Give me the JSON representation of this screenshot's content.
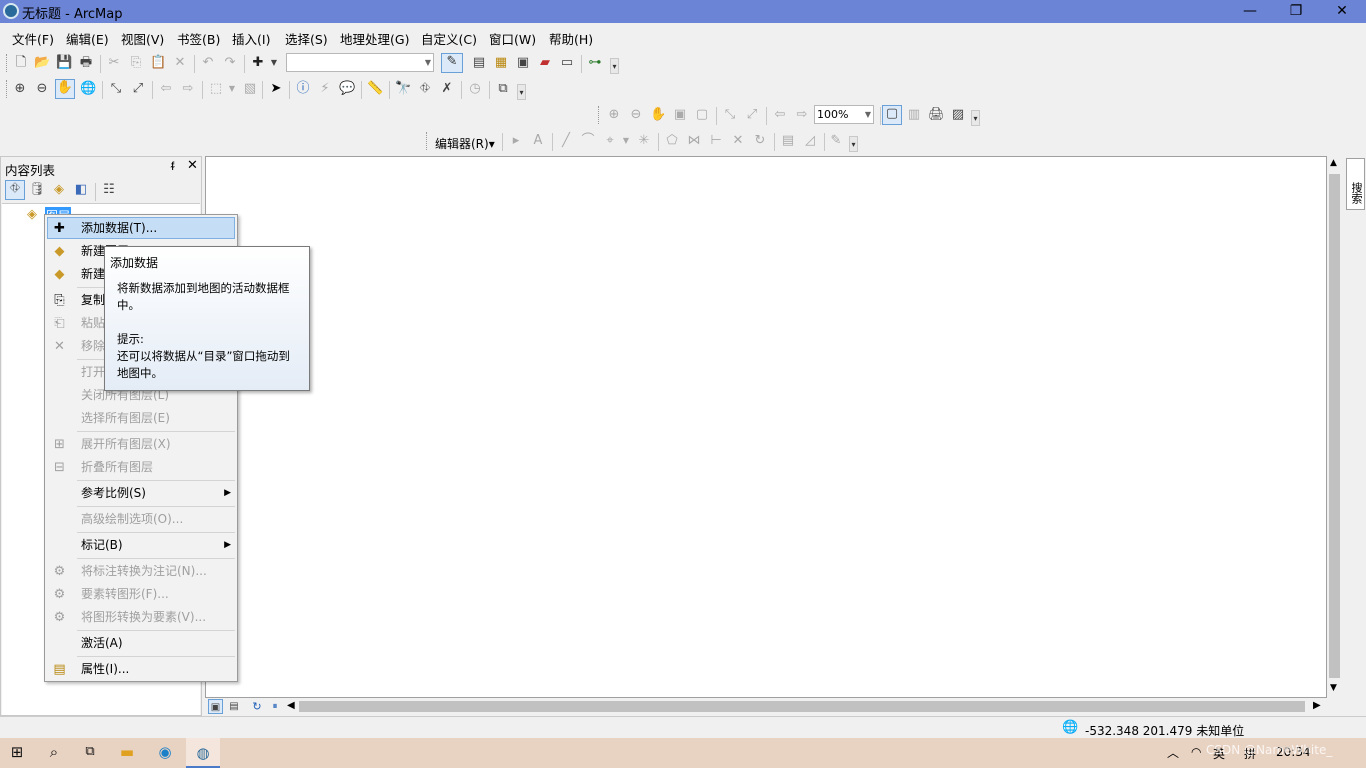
{
  "window": {
    "title": "无标题 - ArcMap",
    "minimize": "—",
    "restore": "❐",
    "close": "✕"
  },
  "menu": [
    "文件(F)",
    "编辑(E)",
    "视图(V)",
    "书签(B)",
    "插入(I)",
    "选择(S)",
    "地理处理(G)",
    "自定义(C)",
    "窗口(W)",
    "帮助(H)"
  ],
  "toolbar": {
    "scale_value": "",
    "zoom_value": "100%",
    "editor_label": "编辑器(R)▾"
  },
  "toc": {
    "title": "内容列表",
    "layer_name": "图层",
    "pin": "ᵮ",
    "close": "✕"
  },
  "context_menu": {
    "items": [
      {
        "label": "添加数据(T)...",
        "icon": "add-data-icon",
        "glyph": "✚",
        "enabled": true
      },
      {
        "label": "新建图层...",
        "icon": "new-layer-icon",
        "glyph": "◆",
        "enabled": true
      },
      {
        "label": "新建图层组",
        "icon": "new-group-icon",
        "glyph": "◆",
        "enabled": true
      },
      {
        "label": "复制",
        "icon": "copy-icon",
        "glyph": "⎘",
        "enabled": true
      },
      {
        "label": "粘贴图层",
        "icon": "paste-icon",
        "glyph": "⎗",
        "enabled": false
      },
      {
        "label": "移除",
        "icon": "remove-icon",
        "glyph": "✕",
        "enabled": false
      },
      {
        "label": "打开所有图层",
        "icon": "",
        "glyph": "",
        "enabled": false
      },
      {
        "label": "关闭所有图层(L)",
        "icon": "",
        "glyph": "",
        "enabled": false
      },
      {
        "label": "选择所有图层(E)",
        "icon": "",
        "glyph": "",
        "enabled": false
      },
      {
        "label": "展开所有图层(X)",
        "icon": "expand-icon",
        "glyph": "⊞",
        "enabled": false
      },
      {
        "label": "折叠所有图层",
        "icon": "collapse-icon",
        "glyph": "⊟",
        "enabled": false
      },
      {
        "label": "参考比例(S)",
        "icon": "",
        "glyph": "",
        "enabled": true,
        "submenu": "▶"
      },
      {
        "label": "高级绘制选项(O)...",
        "icon": "",
        "glyph": "",
        "enabled": false
      },
      {
        "label": "标记(B)",
        "icon": "",
        "glyph": "",
        "enabled": true,
        "submenu": "▶"
      },
      {
        "label": "将标注转换为注记(N)...",
        "icon": "convert-labels-icon",
        "glyph": "⚙",
        "enabled": false
      },
      {
        "label": "要素转图形(F)...",
        "icon": "features-to-graphics-icon",
        "glyph": "⚙",
        "enabled": false
      },
      {
        "label": "将图形转换为要素(V)...",
        "icon": "graphics-to-features-icon",
        "glyph": "⚙",
        "enabled": false
      },
      {
        "label": "激活(A)",
        "icon": "",
        "glyph": "",
        "enabled": true
      },
      {
        "label": "属性(I)...",
        "icon": "properties-icon",
        "glyph": "▤",
        "enabled": true
      }
    ]
  },
  "tooltip": {
    "title": "添加数据",
    "desc1": "将新数据添加到地图的活动数据框",
    "desc2": "中。",
    "tip_label": "提示:",
    "tip1": "还可以将数据从“目录”窗口拖动到",
    "tip2": "地图中。"
  },
  "search_tab": "搜索",
  "status": {
    "coords": "-532.348  201.479 未知单位"
  },
  "taskbar": {
    "ime": "英",
    "ime2": "拼",
    "time": "20:34",
    "watermark": "CSDN @NameWhite_"
  },
  "colors": {
    "titlebar": "#6c84d6",
    "highlight": "#c5ddf5",
    "taskbar": "#e8d2c2"
  }
}
